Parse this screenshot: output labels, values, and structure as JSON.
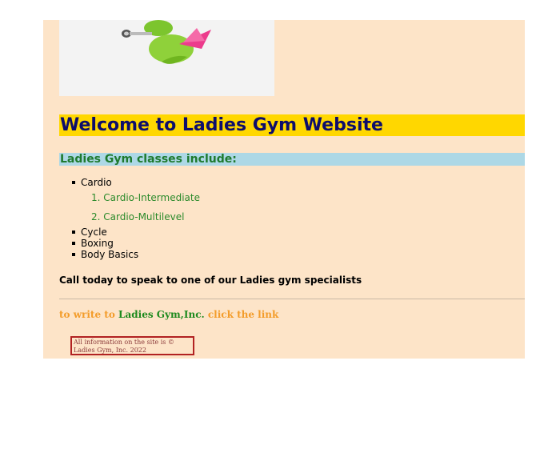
{
  "hero": {
    "image_name": "gym-logo-illustration"
  },
  "welcome_heading": "Welcome to Ladies Gym Website",
  "classes_heading": "Ladies Gym classes include:",
  "classes": {
    "cardio": "Cardio",
    "cardio_sub": [
      "1. Cardio-Intermediate",
      "2. Cardio-Multilevel"
    ],
    "others": [
      "Cycle",
      "Boxing",
      "Body Basics"
    ]
  },
  "call_line": "Call today to speak to one of our Ladies gym specialists",
  "write_line": {
    "prefix": "to write to",
    "brand": "Ladies Gym,Inc.",
    "link": "click the link"
  },
  "copyright": "All information on the site is © Ladies Gym, Inc. 2022",
  "colors": {
    "page_bg": "#fde4c8",
    "welcome_bg": "#ffd700",
    "welcome_text": "#0d0d6b",
    "classes_bg": "#add8e6",
    "classes_text": "#1e7a2e",
    "write_text": "#f39c2a",
    "copyright_border": "#b22222"
  }
}
